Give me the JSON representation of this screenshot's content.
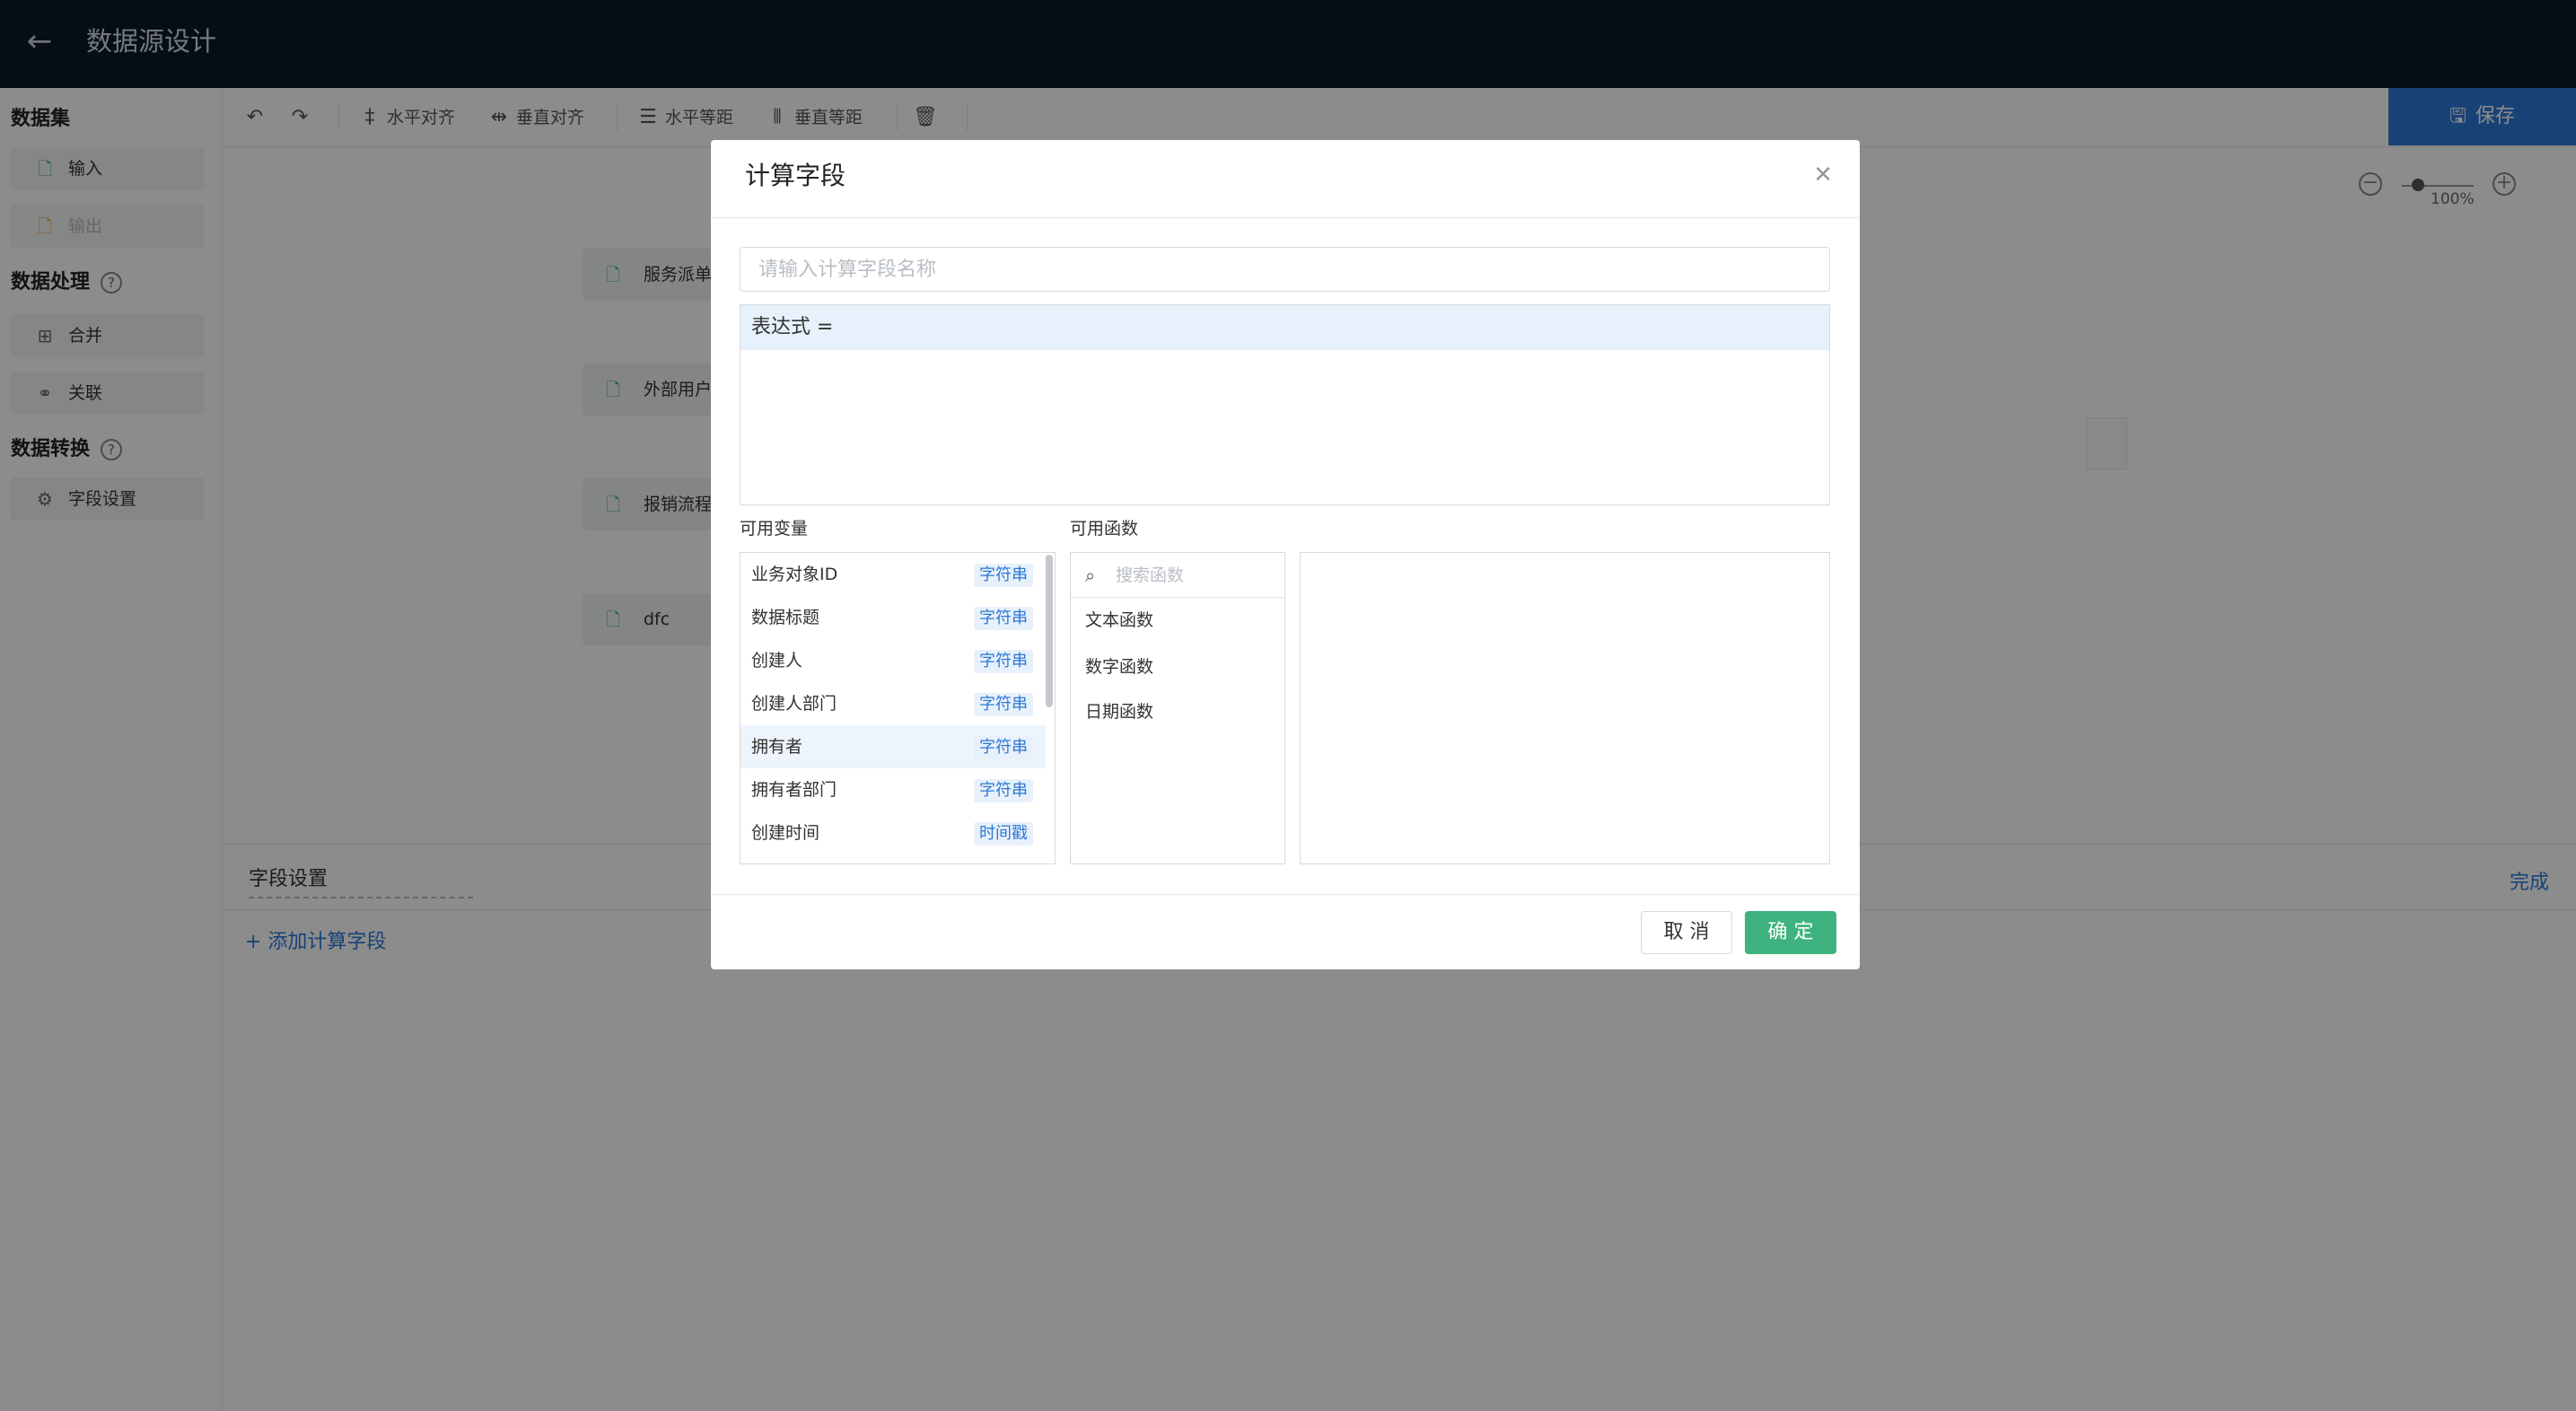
{
  "header": {
    "back_icon": "arrow-left-icon",
    "title": "数据源设计"
  },
  "sidebar": {
    "dataset_title": "数据集",
    "input_label": "输入",
    "output_label": "输出",
    "processing_title": "数据处理",
    "merge_label": "合并",
    "join_label": "关联",
    "transform_title": "数据转换",
    "field_settings_label": "字段设置"
  },
  "toolbar": {
    "align_horizontal": "水平对齐",
    "align_vertical": "垂直对齐",
    "spacing_horizontal": "水平等距",
    "spacing_vertical": "垂直等距",
    "save_label": "保存"
  },
  "canvas": {
    "nodes": [
      "服务派单",
      "外部用户",
      "报销流程",
      "dfc"
    ],
    "zoom_level": "100%"
  },
  "bottom_panel": {
    "title": "字段设置",
    "add_link": "+ 添加计算字段",
    "done_link": "完成"
  },
  "modal": {
    "title": "计算字段",
    "name_placeholder": "请输入计算字段名称",
    "expression_prefix": "表达式 =",
    "variables_label": "可用变量",
    "functions_label": "可用函数",
    "variables": [
      {
        "name": "业务对象ID",
        "type": "字符串"
      },
      {
        "name": "数据标题",
        "type": "字符串"
      },
      {
        "name": "创建人",
        "type": "字符串"
      },
      {
        "name": "创建人部门",
        "type": "字符串"
      },
      {
        "name": "拥有者",
        "type": "字符串"
      },
      {
        "name": "拥有者部门",
        "type": "字符串"
      },
      {
        "name": "创建时间",
        "type": "时间戳"
      }
    ],
    "function_search_placeholder": "搜索函数",
    "functions": [
      "文本函数",
      "数字函数",
      "日期函数"
    ],
    "cancel_label": "取 消",
    "ok_label": "确 定"
  },
  "colors": {
    "header_bg": "#0a1a2a",
    "primary": "#2d78d6",
    "confirm": "#3fb37f"
  }
}
